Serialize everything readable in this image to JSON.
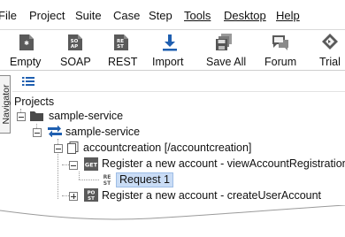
{
  "menubar": {
    "items": [
      "File",
      "Project",
      "Suite",
      "Case",
      "Step",
      "Tools",
      "Desktop",
      "Help"
    ]
  },
  "toolbar": {
    "buttons": [
      {
        "label": "Empty",
        "icon": "empty-project-icon"
      },
      {
        "label": "SOAP",
        "icon": "soap-project-icon"
      },
      {
        "label": "REST",
        "icon": "rest-project-icon"
      },
      {
        "label": "Import",
        "icon": "import-icon"
      },
      {
        "label": "Save All",
        "icon": "save-all-icon"
      },
      {
        "label": "Forum",
        "icon": "forum-icon"
      },
      {
        "label": "Trial",
        "icon": "trial-icon"
      }
    ]
  },
  "navigator": {
    "tab_label": "Navigator",
    "tree": {
      "root_label": "Projects",
      "project": "sample-service",
      "service": "sample-service",
      "resource": "accountcreation [/accountcreation]",
      "method_1": "Register a new account - viewAccountRegistration",
      "request": "Request 1",
      "method_2": "Register a new account - createUserAccount"
    }
  },
  "colors": {
    "accent_blue": "#1f5fb0",
    "selection": "#c9dcf5",
    "icon_gray": "#5a5a5a"
  }
}
